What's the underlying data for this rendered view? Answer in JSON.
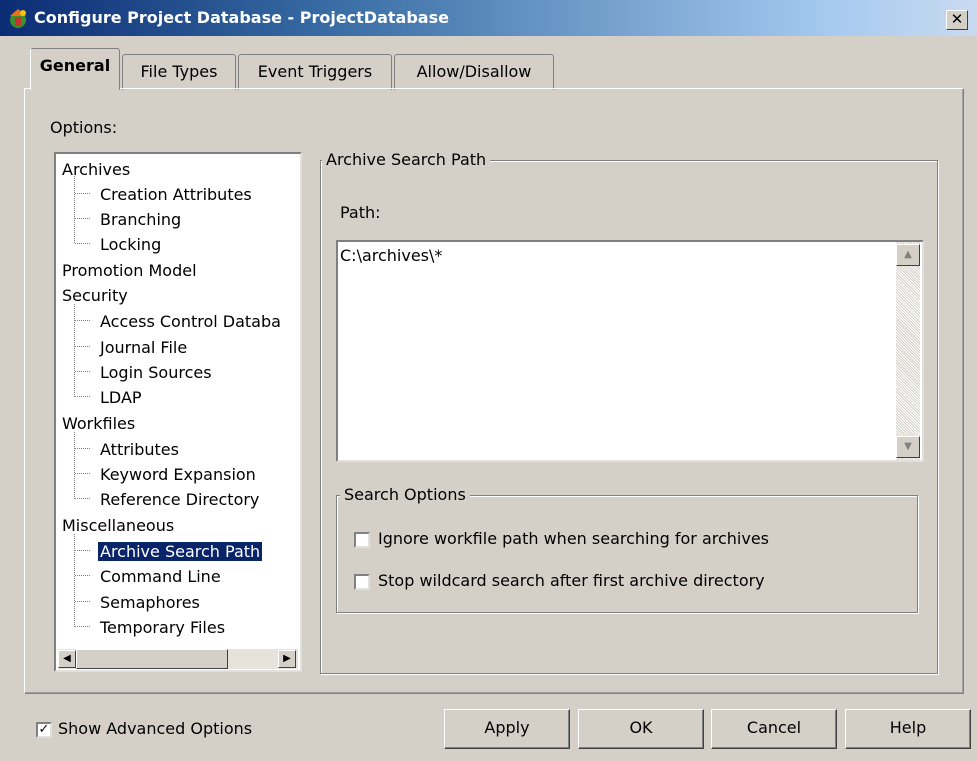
{
  "window": {
    "title": "Configure Project Database - ProjectDatabase",
    "close_glyph": "✕"
  },
  "tabs": [
    {
      "label": "General",
      "active": true
    },
    {
      "label": "File Types",
      "active": false
    },
    {
      "label": "Event Triggers",
      "active": false
    },
    {
      "label": "Allow/Disallow",
      "active": false
    }
  ],
  "options": {
    "label": "Options:",
    "tree": [
      {
        "label": "Archives",
        "level": 0
      },
      {
        "label": "Creation Attributes",
        "level": 1
      },
      {
        "label": "Branching",
        "level": 1
      },
      {
        "label": "Locking",
        "level": 1
      },
      {
        "label": "Promotion Model",
        "level": 0
      },
      {
        "label": "Security",
        "level": 0
      },
      {
        "label": "Access Control Databa",
        "level": 1
      },
      {
        "label": "Journal File",
        "level": 1
      },
      {
        "label": "Login Sources",
        "level": 1
      },
      {
        "label": "LDAP",
        "level": 1
      },
      {
        "label": "Workfiles",
        "level": 0
      },
      {
        "label": "Attributes",
        "level": 1
      },
      {
        "label": "Keyword Expansion",
        "level": 1
      },
      {
        "label": "Reference Directory",
        "level": 1
      },
      {
        "label": "Miscellaneous",
        "level": 0
      },
      {
        "label": "Archive Search Path",
        "level": 1,
        "selected": true
      },
      {
        "label": "Command Line",
        "level": 1
      },
      {
        "label": "Semaphores",
        "level": 1
      },
      {
        "label": "Temporary Files",
        "level": 1
      }
    ]
  },
  "archive_search_path": {
    "group_title": "Archive Search Path",
    "path_label": "Path:",
    "path_value": "C:\\archives\\*"
  },
  "search_options": {
    "group_title": "Search Options",
    "checkboxes": [
      {
        "label": "Ignore workfile path when searching for archives",
        "checked": false
      },
      {
        "label": "Stop wildcard search after first archive directory",
        "checked": false
      }
    ]
  },
  "footer": {
    "show_advanced_label": "Show Advanced Options",
    "show_advanced_checked": true,
    "buttons": {
      "apply": "Apply",
      "ok": "OK",
      "cancel": "Cancel",
      "help": "Help"
    }
  },
  "colors": {
    "title_gradient_start": "#0b2c74",
    "title_gradient_end": "#c9daf0",
    "selection": "#0a246a",
    "face": "#d4d0c8"
  }
}
